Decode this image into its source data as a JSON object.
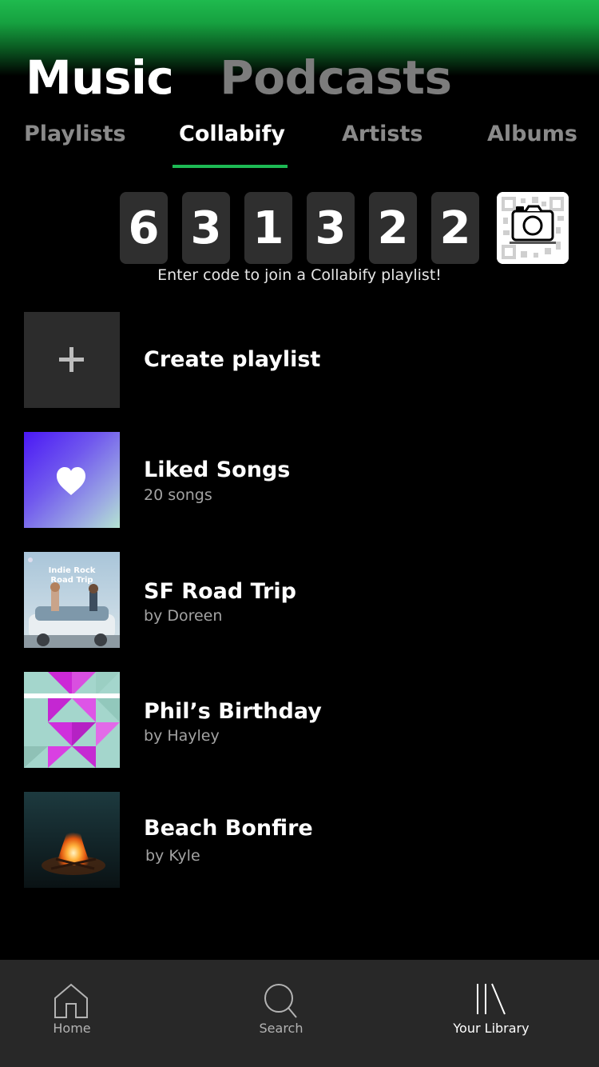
{
  "header": {
    "tabs": [
      {
        "label": "Music",
        "active": true
      },
      {
        "label": "Podcasts",
        "active": false
      }
    ]
  },
  "subtabs": {
    "items": [
      {
        "label": "Playlists",
        "active": false
      },
      {
        "label": "Collabify",
        "active": true
      },
      {
        "label": "Artists",
        "active": false
      },
      {
        "label": "Albums",
        "active": false
      }
    ]
  },
  "code": {
    "digits": [
      "6",
      "3",
      "1",
      "3",
      "2",
      "2"
    ],
    "hint": "Enter code to join a Collabify playlist!",
    "scan_icon": "camera-qr-icon"
  },
  "create": {
    "label": "Create playlist",
    "icon": "plus-icon"
  },
  "playlists": [
    {
      "title": "Liked Songs",
      "subtitle": "20 songs",
      "cover": "liked-songs-heart",
      "cover_text": ""
    },
    {
      "title": "SF Road Trip",
      "subtitle": "by Doreen",
      "cover": "indie-rock-road-trip",
      "cover_text": "Indie Rock Road Trip"
    },
    {
      "title": "Phil’s Birthday",
      "subtitle": "by Hayley",
      "cover": "geometric-pink-mix",
      "cover_text": ""
    },
    {
      "title": "Beach Bonfire",
      "subtitle": "by Kyle",
      "cover": "bonfire-photo",
      "cover_text": ""
    }
  ],
  "nav": {
    "items": [
      {
        "label": "Home",
        "icon": "home-icon",
        "active": false
      },
      {
        "label": "Search",
        "icon": "search-icon",
        "active": false
      },
      {
        "label": "Your Library",
        "icon": "library-icon",
        "active": true
      }
    ]
  },
  "colors": {
    "accent": "#1db954",
    "background": "#000000",
    "digit_bg": "#2f2f2f",
    "nav_bg": "#282828",
    "liked_gradient_start": "#4a18f5",
    "liked_gradient_end": "#a9dcd5"
  }
}
